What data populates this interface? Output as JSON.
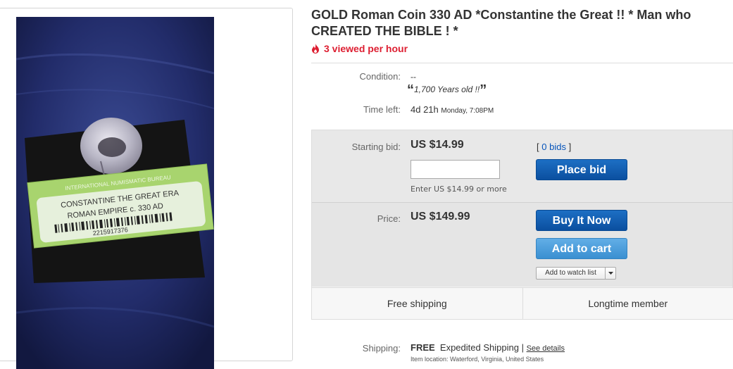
{
  "listing": {
    "title": "GOLD Roman Coin 330 AD *Constantine the Great !! * Man who CREATED THE BIBLE ! *",
    "hot_text": "3 viewed per hour",
    "hot_icon": "flame-icon"
  },
  "photo": {
    "label_top": "INTERNATIONAL NUMISMATIC BUREAU",
    "label_line1": "CONSTANTINE THE GREAT ERA",
    "label_line2": "ROMAN EMPIRE c. 330 AD",
    "label_code": "2215917376"
  },
  "condition": {
    "label": "Condition:",
    "value": "--",
    "quote": "1,700 Years old !!",
    "open_quote": "“",
    "close_quote": "”"
  },
  "time_left": {
    "label": "Time left:",
    "value": "4d 21h",
    "end": "Monday, 7:08PM"
  },
  "bid": {
    "label": "Starting bid:",
    "amount": "US $14.99",
    "bids_open": "[",
    "bids_count": "0 bids",
    "bids_close": "]",
    "input_value": "",
    "hint": "Enter US $14.99 or more",
    "place_bid_label": "Place bid"
  },
  "buy": {
    "label": "Price:",
    "amount": "US $149.99",
    "buy_now_label": "Buy It Now",
    "add_cart_label": "Add to cart",
    "watch_label": "Add to watch list"
  },
  "perks": {
    "left": "Free shipping",
    "right": "Longtime member"
  },
  "shipping": {
    "label": "Shipping:",
    "free": "FREE",
    "method": "Expedited Shipping",
    "sep": "|",
    "details_link": "See details",
    "location": "Item location:  Waterford, Virginia, United States"
  },
  "colors": {
    "hot_red": "#dd1e31",
    "button_blue": "#0b4f9f",
    "button_light_blue": "#3a8fd1",
    "link_blue": "#0654ba"
  }
}
